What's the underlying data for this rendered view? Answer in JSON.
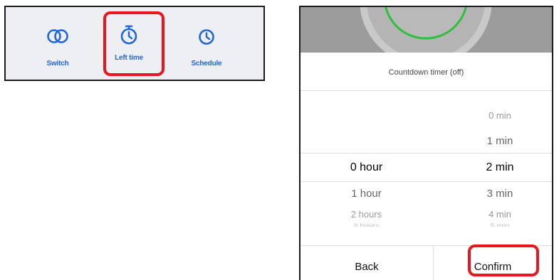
{
  "tabs": [
    {
      "label": "Switch",
      "icon": "double-circle-icon"
    },
    {
      "label": "Left time",
      "icon": "stopwatch-icon"
    },
    {
      "label": "Schedule",
      "icon": "clock-icon"
    }
  ],
  "dialog": {
    "title": "Countdown timer (off)",
    "hours": [
      "0 hour",
      "1 hour",
      "2 hours",
      "3 hours"
    ],
    "minutes": [
      "0 min",
      "1 min",
      "2 min",
      "3 min",
      "4 min",
      "5 min"
    ],
    "selected_hour": "0 hour",
    "selected_minute": "2 min",
    "back_label": "Back",
    "confirm_label": "Confirm"
  },
  "colors": {
    "accent": "#1f66d6",
    "highlight": "#e8171e",
    "ring": "#2fbf3a"
  }
}
